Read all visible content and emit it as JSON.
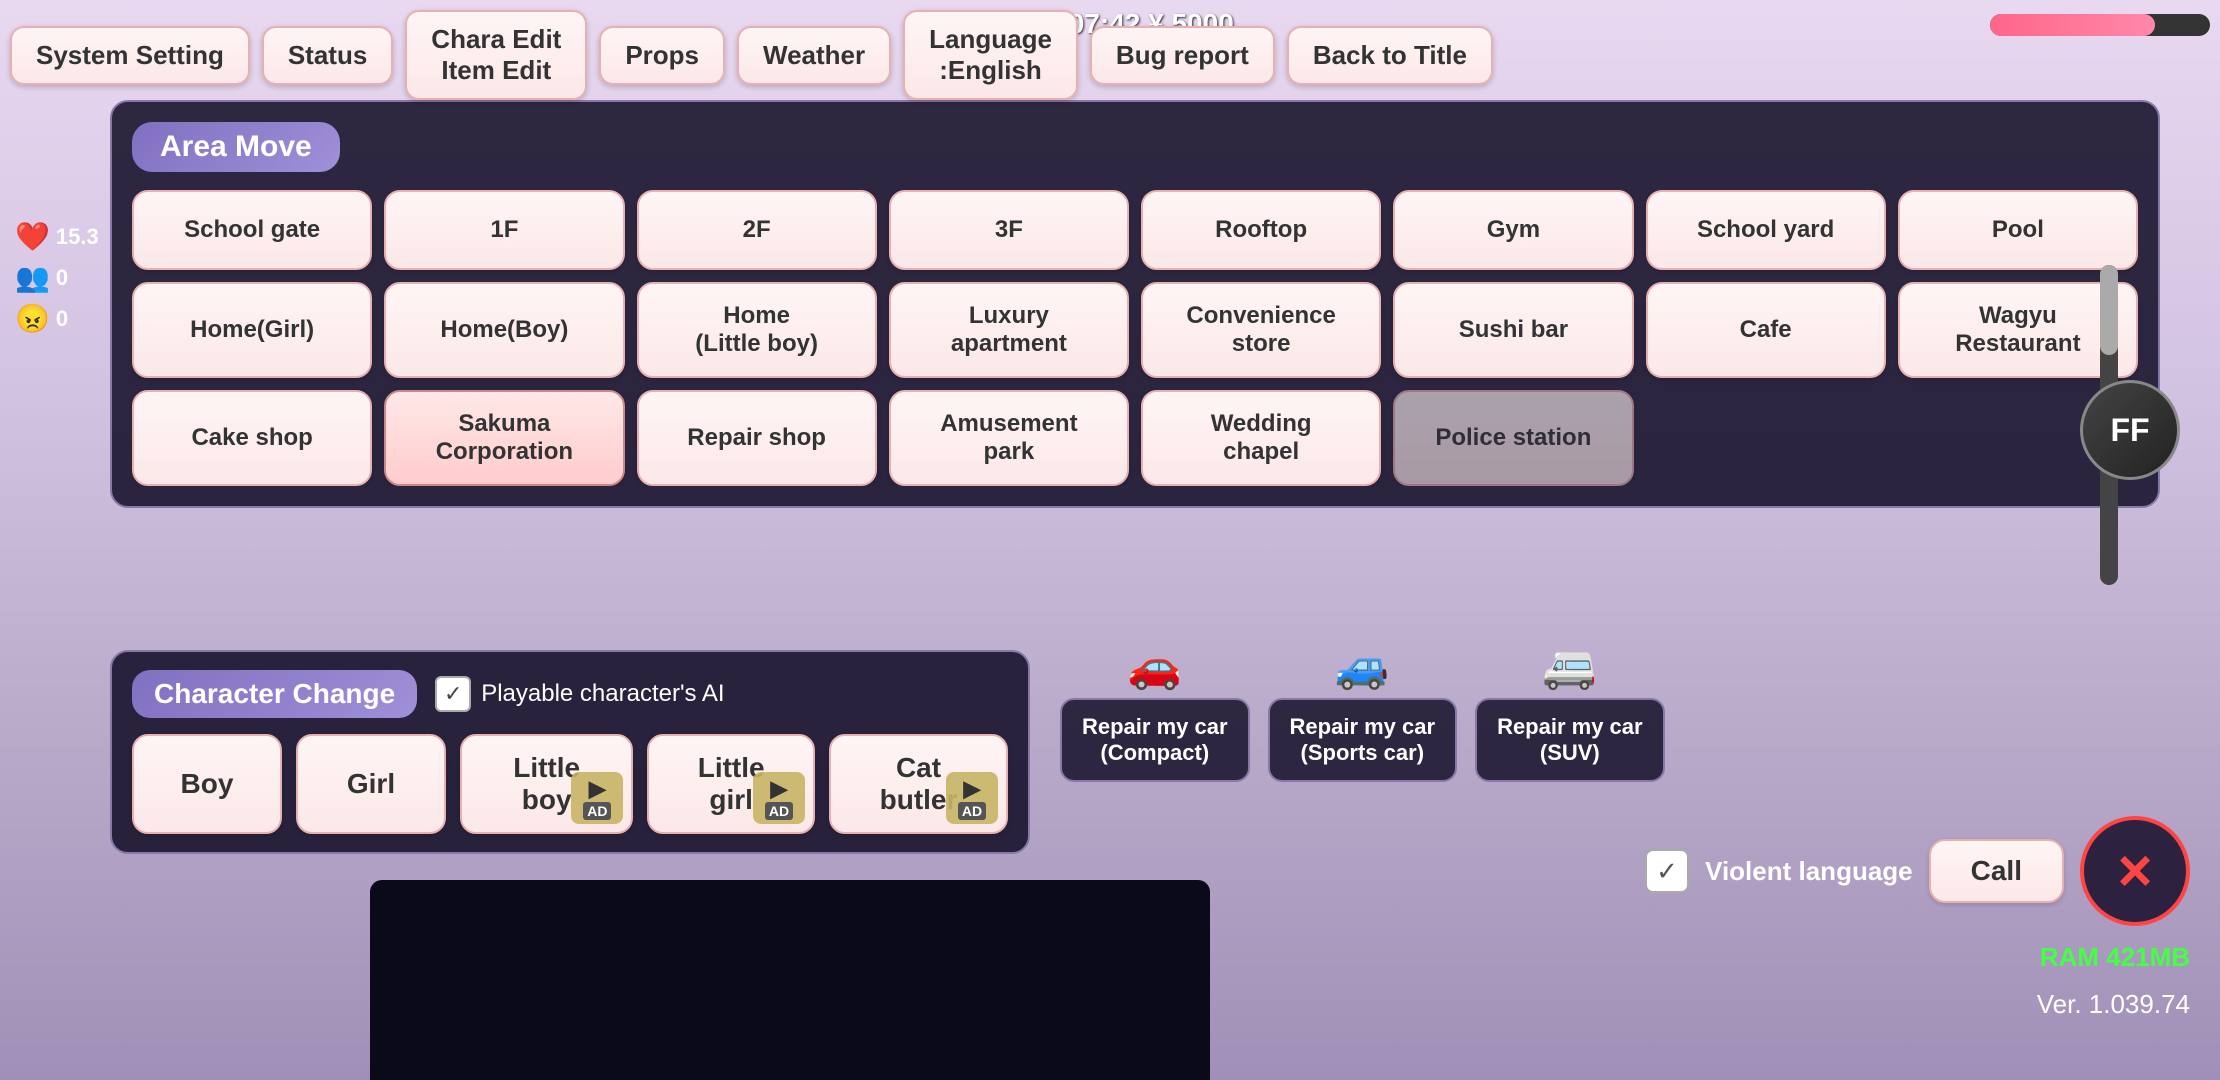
{
  "game": {
    "day_info": "Day 1  07:42 ¥ 5000"
  },
  "toolbar": {
    "system_setting": "System Setting",
    "status": "Status",
    "chara_edit": "Chara Edit\nItem Edit",
    "props": "Props",
    "weather": "Weather",
    "language": "Language\n:English",
    "bug_report": "Bug report",
    "back_to_title": "Back to Title"
  },
  "area_move": {
    "title": "Area Move",
    "locations": [
      {
        "id": "school-gate",
        "label": "School gate"
      },
      {
        "id": "1f",
        "label": "1F"
      },
      {
        "id": "2f",
        "label": "2F"
      },
      {
        "id": "3f",
        "label": "3F"
      },
      {
        "id": "rooftop",
        "label": "Rooftop"
      },
      {
        "id": "gym",
        "label": "Gym"
      },
      {
        "id": "school-yard",
        "label": "School yard"
      },
      {
        "id": "pool",
        "label": "Pool"
      },
      {
        "id": "home-girl",
        "label": "Home(Girl)"
      },
      {
        "id": "home-boy",
        "label": "Home(Boy)"
      },
      {
        "id": "home-little-boy",
        "label": "Home\n(Little boy)"
      },
      {
        "id": "luxury-apartment",
        "label": "Luxury\napartment"
      },
      {
        "id": "convenience-store",
        "label": "Convenience\nstore"
      },
      {
        "id": "sushi-bar",
        "label": "Sushi bar"
      },
      {
        "id": "cafe",
        "label": "Cafe"
      },
      {
        "id": "wagyu-restaurant",
        "label": "Wagyu\nRestaurant"
      },
      {
        "id": "cake-shop",
        "label": "Cake shop"
      },
      {
        "id": "sakuma-corporation",
        "label": "Sakuma\nCorporation"
      },
      {
        "id": "repair-shop",
        "label": "Repair shop"
      },
      {
        "id": "amusement-park",
        "label": "Amusement\npark"
      },
      {
        "id": "wedding-chapel",
        "label": "Wedding\nchapel"
      },
      {
        "id": "police-station",
        "label": "Police station"
      }
    ]
  },
  "character_change": {
    "title": "Character Change",
    "ai_label": "Playable character's AI",
    "ai_checked": true,
    "characters": [
      {
        "id": "boy",
        "label": "Boy",
        "locked": false,
        "ad": false
      },
      {
        "id": "girl",
        "label": "Girl",
        "locked": false,
        "ad": false
      },
      {
        "id": "little-boy",
        "label": "Little boy",
        "locked": true,
        "ad": true
      },
      {
        "id": "little-girl",
        "label": "Little girl",
        "locked": true,
        "ad": true
      },
      {
        "id": "cat-butler",
        "label": "Cat butler",
        "locked": true,
        "ad": true
      }
    ]
  },
  "car_repair": {
    "compact": "Repair my car\n(Compact)",
    "sports_car": "Repair my car\n(Sports car)",
    "suv": "Repair my car\n(SUV)"
  },
  "controls": {
    "violent_language": "Violent language",
    "violent_checked": true,
    "call_label": "Call",
    "close_label": "×",
    "ram_label": "RAM 421MB",
    "version_label": "Ver. 1.039.74"
  },
  "social": {
    "likes": "15.3",
    "value1": "0",
    "value2": "0"
  },
  "ff_label": "FF"
}
